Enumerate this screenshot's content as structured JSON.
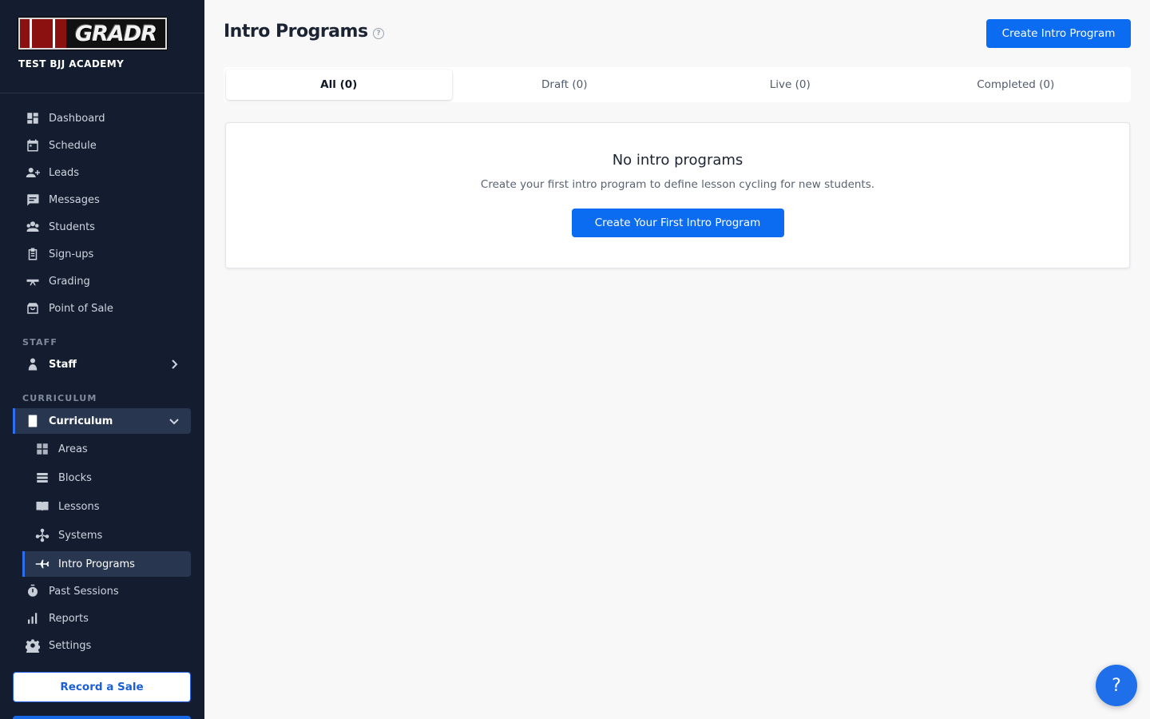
{
  "brand": {
    "logo_text": "GRADR",
    "academy_name": "TEST BJJ ACADEMY",
    "logo_colors": [
      "#8b1010",
      "#ffffff",
      "#8b1010",
      "#ffffff",
      "#8b1010"
    ]
  },
  "sidebar": {
    "main_items": [
      {
        "label": "Dashboard",
        "icon": "dashboard-icon"
      },
      {
        "label": "Schedule",
        "icon": "calendar-icon"
      },
      {
        "label": "Leads",
        "icon": "person-add-icon"
      },
      {
        "label": "Messages",
        "icon": "chat-icon"
      },
      {
        "label": "Students",
        "icon": "students-icon"
      },
      {
        "label": "Sign-ups",
        "icon": "clipboard-icon"
      },
      {
        "label": "Grading",
        "icon": "belt-icon"
      },
      {
        "label": "Point of Sale",
        "icon": "shopping-bag-icon"
      }
    ],
    "staff_section": "STAFF",
    "staff_item": {
      "label": "Staff",
      "icon": "person-icon"
    },
    "curriculum_section": "CURRICULUM",
    "curriculum_item": {
      "label": "Curriculum",
      "icon": "book-icon"
    },
    "curriculum_sub": [
      {
        "label": "Areas",
        "icon": "grid-icon"
      },
      {
        "label": "Blocks",
        "icon": "layers-icon"
      },
      {
        "label": "Lessons",
        "icon": "open-book-icon"
      },
      {
        "label": "Systems",
        "icon": "network-icon"
      },
      {
        "label": "Intro Programs",
        "icon": "plane-icon"
      }
    ],
    "bottom_items": [
      {
        "label": "Past Sessions",
        "icon": "stopwatch-icon"
      },
      {
        "label": "Reports",
        "icon": "bar-chart-icon"
      },
      {
        "label": "Settings",
        "icon": "gear-icon"
      }
    ],
    "record_sale_label": "Record a Sale"
  },
  "main": {
    "title": "Intro Programs",
    "help_glyph": "?",
    "create_button": "Create Intro Program",
    "tabs": [
      {
        "label": "All (0)",
        "active": true
      },
      {
        "label": "Draft (0)",
        "active": false
      },
      {
        "label": "Live (0)",
        "active": false
      },
      {
        "label": "Completed (0)",
        "active": false
      }
    ],
    "empty_state": {
      "title": "No intro programs",
      "subtitle": "Create your first intro program to define lesson cycling for new students.",
      "button": "Create Your First Intro Program"
    }
  },
  "fab_label": "?",
  "colors": {
    "accent": "#0b6cf2",
    "sidebar_bg": "#131d2f",
    "active_bg": "#283650"
  }
}
